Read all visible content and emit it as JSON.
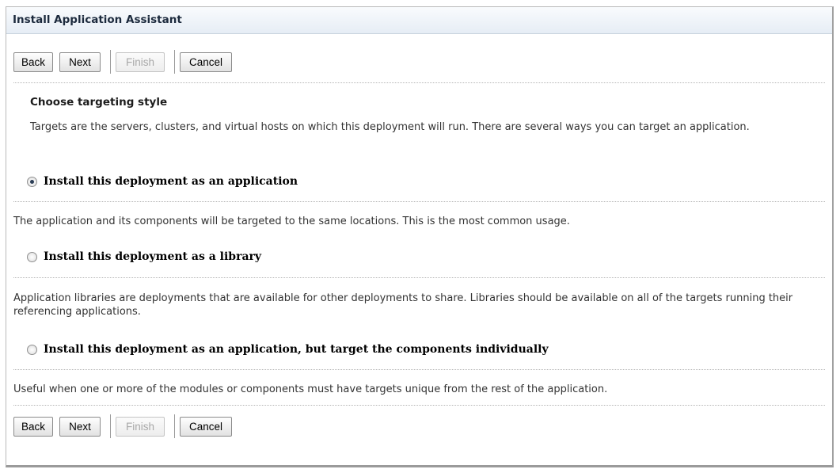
{
  "panel": {
    "title": "Install Application Assistant"
  },
  "buttons": {
    "back": "Back",
    "next": "Next",
    "finish": "Finish",
    "cancel": "Cancel"
  },
  "section": {
    "heading": "Choose targeting style",
    "intro": "Targets are the servers, clusters, and virtual hosts on which this deployment will run. There are several ways you can target an application."
  },
  "options": [
    {
      "label": "Install this deployment as an application",
      "selected": true,
      "description": "The application and its components will be targeted to the same locations. This is the most common usage."
    },
    {
      "label": "Install this deployment as a library",
      "selected": false,
      "description": "Application libraries are deployments that are available for other deployments to share. Libraries should be available on all of the targets running their referencing applications."
    },
    {
      "label": "Install this deployment as an application, but target the components individually",
      "selected": false,
      "description": "Useful when one or more of the modules or components must have targets unique from the rest of the application."
    }
  ]
}
